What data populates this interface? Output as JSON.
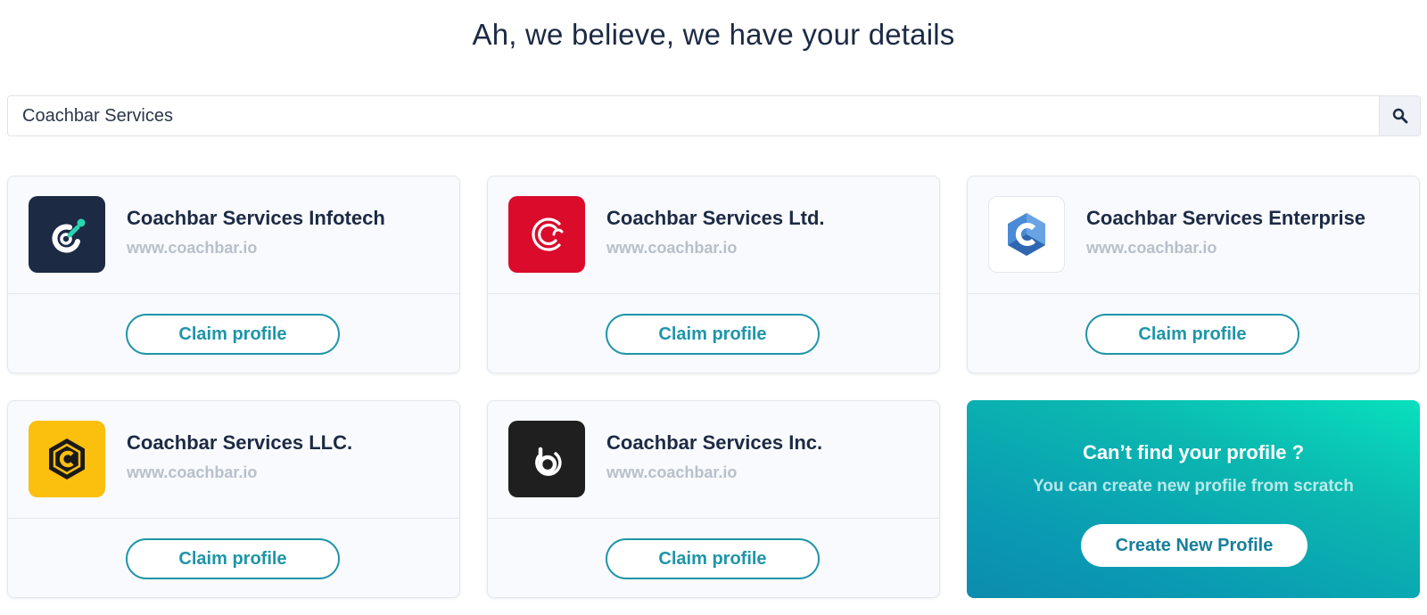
{
  "header": {
    "title": "Ah, we believe, we have your details"
  },
  "search": {
    "value": "Coachbar Services",
    "icon": "search-icon"
  },
  "profiles": [
    {
      "name": "Coachbar Services Infotech",
      "url": "www.coachbar.io",
      "button": "Claim profile",
      "logo_bg": "#1c2a44",
      "logo_accent": "#2ad4b0"
    },
    {
      "name": "Coachbar Services Ltd.",
      "url": "www.coachbar.io",
      "button": "Claim profile",
      "logo_bg": "#db0b2b",
      "logo_accent": "#ffffff"
    },
    {
      "name": "Coachbar Services Enterprise",
      "url": "www.coachbar.io",
      "button": "Claim profile",
      "logo_bg": "#ffffff",
      "logo_accent": "#3b7cc9"
    },
    {
      "name": "Coachbar Services LLC.",
      "url": "www.coachbar.io",
      "button": "Claim profile",
      "logo_bg": "#fbbf0e",
      "logo_accent": "#1a1a1a"
    },
    {
      "name": "Coachbar Services Inc.",
      "url": "www.coachbar.io",
      "button": "Claim profile",
      "logo_bg": "#1f1f1f",
      "logo_accent": "#ffffff"
    }
  ],
  "cta": {
    "title": "Can’t find your profile ?",
    "subtitle": "You can create new profile from scratch",
    "button": "Create New Profile"
  },
  "colors": {
    "accent": "#1f95a8",
    "text": "#1c2a44",
    "muted": "#b9c0ca"
  }
}
